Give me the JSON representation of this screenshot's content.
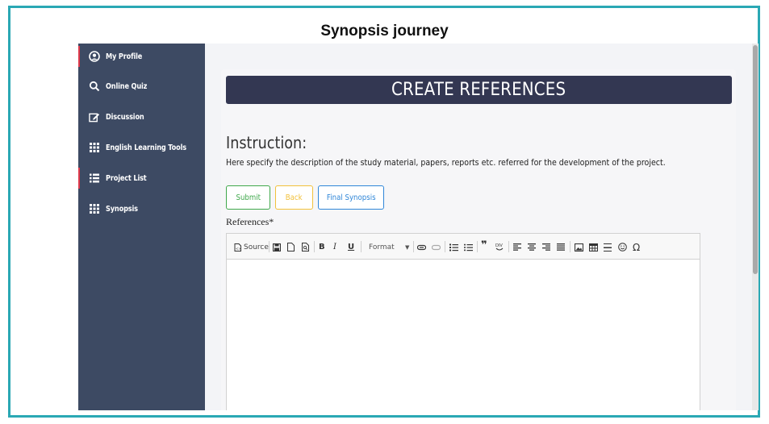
{
  "caption": "Synopsis journey",
  "sidebar": {
    "items": [
      {
        "label": "My Profile",
        "icon": "user-circle-icon",
        "marked": true
      },
      {
        "label": "Online Quiz",
        "icon": "search-icon",
        "marked": false
      },
      {
        "label": "Discussion",
        "icon": "edit-icon",
        "marked": false
      },
      {
        "label": "English Learning Tools",
        "icon": "grid-icon",
        "marked": false
      },
      {
        "label": "Project List",
        "icon": "list-icon",
        "marked": true
      },
      {
        "label": "Synopsis",
        "icon": "grid-icon",
        "marked": false
      }
    ]
  },
  "main": {
    "title": "CREATE REFERENCES",
    "instruction_heading": "Instruction:",
    "instruction_text": "Here specify the description of the study material, papers, reports etc. referred for the development of the project.",
    "buttons": {
      "submit": "Submit",
      "back": "Back",
      "final_synopsis": "Final Synopsis"
    },
    "references_label": "References*",
    "editor": {
      "source_label": "Source",
      "format_label": "Format",
      "value": ""
    }
  },
  "colors": {
    "sidebar_bg": "#3d4a63",
    "title_bar_bg": "#333752",
    "submit": "#3fa84b",
    "back": "#f2c13b",
    "final_synopsis": "#2f86d8",
    "frame_border": "#2aa8b4",
    "active_marker": "#e0394b"
  }
}
